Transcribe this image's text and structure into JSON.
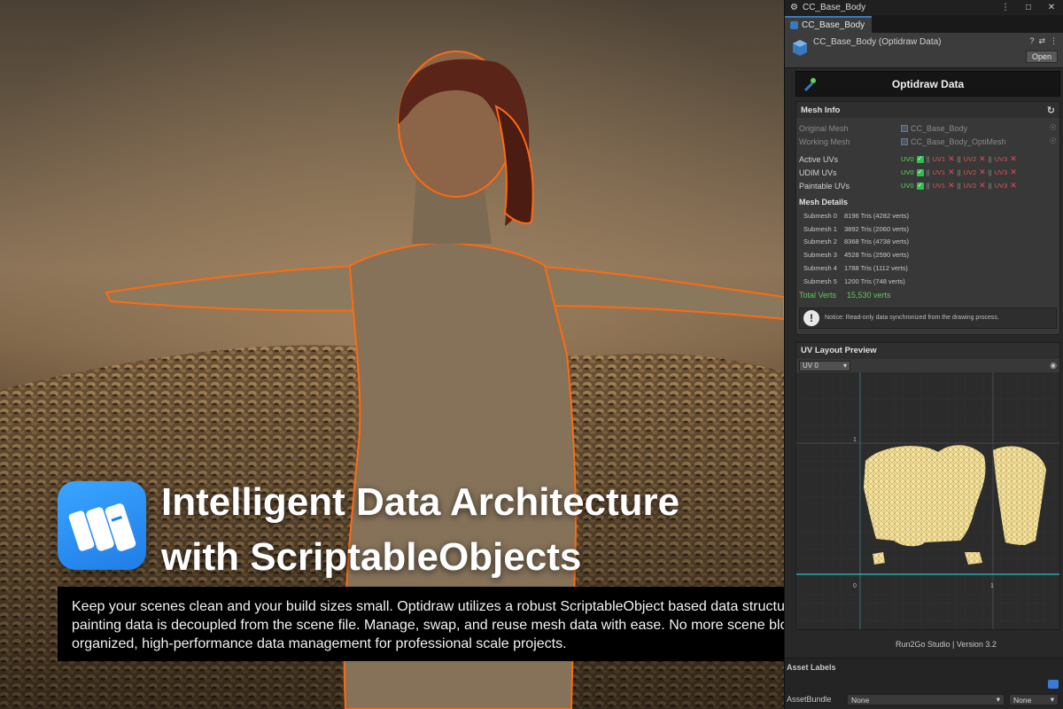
{
  "headline": {
    "line1": "Intelligent Data Architecture",
    "line2": "with ScriptableObjects",
    "description": "Keep your scenes clean and your build sizes small. Optidraw utilizes a robust ScriptableObject based data structure, ensuring all painting data is decoupled from the scene file. Manage, swap, and reuse mesh data with ease. No more scene bloat just organized, high-performance data management for professional scale projects."
  },
  "window": {
    "title": "CC_Base_Body",
    "tab_label": "CC_Base_Body",
    "controls": [
      "⋮",
      "□",
      "✕"
    ]
  },
  "asset_header": {
    "title": "CC_Base_Body (Optidraw Data)",
    "open_label": "Open",
    "icons": [
      "help-icon",
      "settings-icon",
      "menu-icon"
    ]
  },
  "optidraw": {
    "title": "Optidraw Data"
  },
  "mesh_info": {
    "heading": "Mesh Info",
    "original_mesh_label": "Original Mesh",
    "original_mesh_value": "CC_Base_Body",
    "working_mesh_label": "Working Mesh",
    "working_mesh_value": "CC_Base_Body_OptiMesh",
    "uv_rows": [
      {
        "label": "Active UVs"
      },
      {
        "label": "UDIM UVs"
      },
      {
        "label": "Paintable UVs"
      }
    ],
    "uv_channels": [
      "UV0",
      "UV1",
      "UV2",
      "UV3"
    ],
    "uv_separator": "||",
    "details_heading": "Mesh Details",
    "submeshes": [
      {
        "name": "Submesh 0",
        "info": "8196 Tris (4282 verts)"
      },
      {
        "name": "Submesh 1",
        "info": "3892 Tris (2060 verts)"
      },
      {
        "name": "Submesh 2",
        "info": "8368 Tris (4738 verts)"
      },
      {
        "name": "Submesh 3",
        "info": "4528 Tris (2590 verts)"
      },
      {
        "name": "Submesh 4",
        "info": "1788 Tris (1112 verts)"
      },
      {
        "name": "Submesh 5",
        "info": "1200 Tris (748 verts)"
      }
    ],
    "total_label": "Total Verts",
    "total_value": "15,530 verts",
    "notice_text": "Notice: Read-only data synchronized from the drawing process."
  },
  "uv_preview": {
    "heading": "UV Layout Preview",
    "channel": "UV 0",
    "axis_labels": {
      "x0": "0",
      "x1": "1",
      "y0": "0",
      "y1": "1"
    }
  },
  "footer": {
    "studio": "Run2Go Studio | Version 3.2"
  },
  "asset_labels": {
    "heading": "Asset Labels",
    "assetbundle_label": "AssetBundle",
    "bundle_value": "None",
    "variant_value": "None"
  },
  "colors": {
    "accent_blue": "#3a79bb",
    "logo_blue": "#1f7de8",
    "uv_on": "#5fd35f",
    "uv_off": "#e84a5a",
    "uv_mesh": "#f5e4a0",
    "outline_orange": "#ff6a10"
  }
}
